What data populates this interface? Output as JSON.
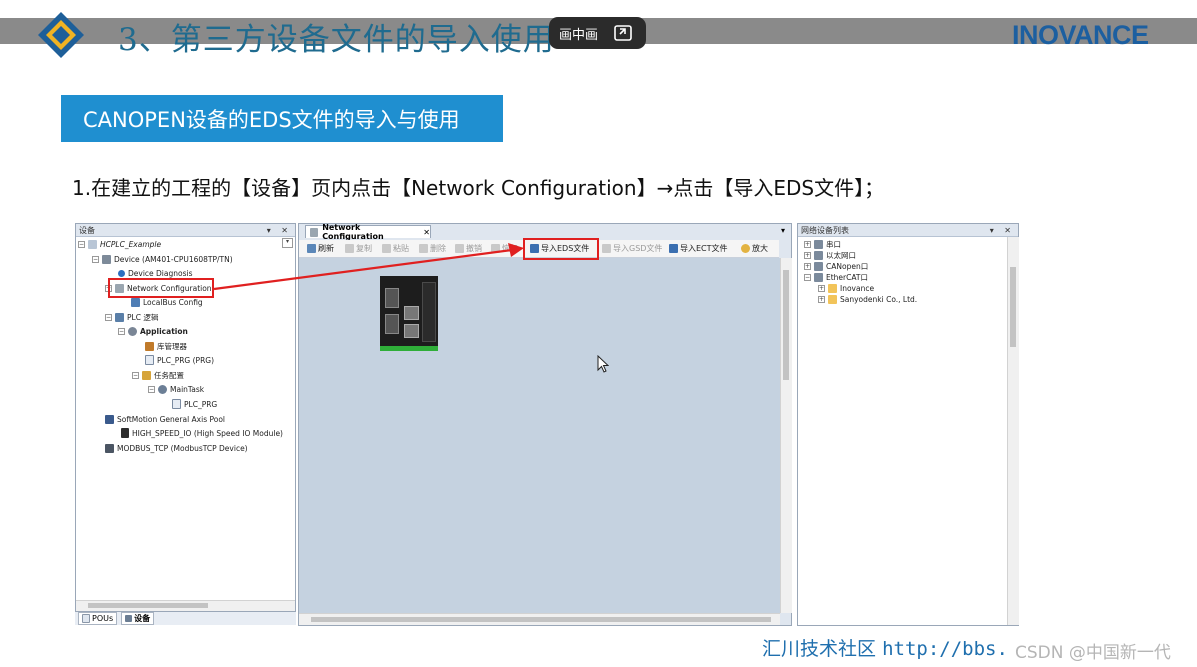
{
  "slide": {
    "title": "3、第三方设备文件的导入使用",
    "brand": "INOVANCE",
    "section": "CANOPEN设备的EDS文件的导入与使用",
    "instruction": "1.在建立的工程的【设备】页内点击【Network Configuration】→点击【导入EDS文件】；",
    "footer_cn": "汇川技术社区",
    "footer_url": "http://bbs.",
    "watermark": "CSDN @中国新一代"
  },
  "pip": {
    "label": "画中画"
  },
  "left_panel": {
    "title": "设备",
    "tree": {
      "project": "HCPLC_Example",
      "device": "Device (AM401-CPU1608TP/TN)",
      "diagnosis": "Device Diagnosis",
      "network": "Network Configuration",
      "localbus": "LocalBus Config",
      "plc_logic": "PLC 逻辑",
      "application": "Application",
      "library": "库管理器",
      "plc_prg": "PLC_PRG (PRG)",
      "task_config": "任务配置",
      "main_task": "MainTask",
      "main_task_prg": "PLC_PRG",
      "softmotion": "SoftMotion General Axis Pool",
      "high_speed": "HIGH_SPEED_IO (High Speed IO Module)",
      "modbus": "MODBUS_TCP (ModbusTCP Device)"
    },
    "tabs": {
      "pous": "POUs",
      "devices": "设备"
    }
  },
  "editor": {
    "tab_label": "Network Configuration",
    "toolbar": {
      "refresh": "刷新",
      "copy": "复制",
      "paste": "粘贴",
      "delete": "删除",
      "undo": "撤销",
      "redo": "恢复",
      "import_eds": "导入EDS文件",
      "import_gsd": "导入GSD文件",
      "import_ect": "导入ECT文件",
      "zoom": "放大"
    }
  },
  "right_panel": {
    "title": "网络设备列表",
    "items": {
      "serial": "串口",
      "ethernet": "以太网口",
      "canopen": "CANopen口",
      "ethercat": "EtherCAT口",
      "inovance": "Inovance",
      "sanyodenki": "Sanyodenki Co., Ltd."
    }
  },
  "colors": {
    "title": "#1f6b8f",
    "brand": "#1c5fa0",
    "section_bg": "#1f8fd0",
    "highlight": "#e02020",
    "canvas": "#c5d2e0"
  }
}
